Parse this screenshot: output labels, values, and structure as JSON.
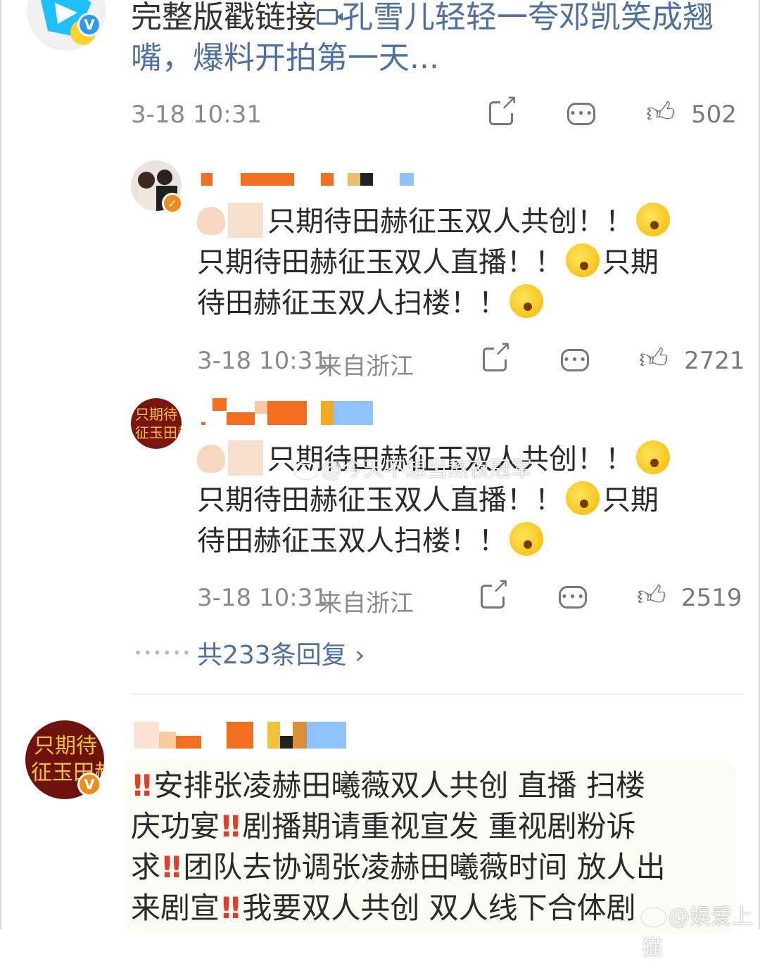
{
  "colors": {
    "link": "#4d6fa8",
    "meta_text": "#8a8a8a",
    "alert_red": "#e43b2a",
    "verified_blue": "#2b9bf0",
    "verified_orange": "#f08a1a",
    "quote_bg": "#fbfcf3"
  },
  "top_post": {
    "text_plain": "完整版戳链接",
    "link_icon": "video-icon",
    "link_text": "孔雪儿轻轻一夸邓凯笑成翘嘴，爆料开拍第一天...",
    "time": "3-18 10:31",
    "like_count": "502",
    "badge": "V"
  },
  "replies": [
    {
      "username": "",
      "line1_text": "只期待田赫征玉双人共创！！",
      "line2_text": "只期待田赫征玉双人直播！！",
      "line2_tail": "只期",
      "line3_text": "待田赫征玉双人扫楼！！",
      "time": "3-18 10:31",
      "location": "来自浙江",
      "like_count": "2721"
    },
    {
      "username": "",
      "line1_text": "只期待田赫征玉双人共创！！",
      "line2_text": "只期待田赫征玉双人直播！！",
      "line2_tail": "只期",
      "line3_text": "待田赫征玉双人扫楼！！",
      "time": "3-18 10:31",
      "location": "来自浙江",
      "like_count": "2519"
    }
  ],
  "more_replies": {
    "label": "共233条回复",
    "chevron": "›"
  },
  "bottom_comment": {
    "badge": "V",
    "avatar_text": "只期待征玉田赫",
    "seg1": "安排张凌赫田曦薇双人共创 直播 扫楼",
    "seg2a": "庆功宴",
    "seg2b": "剧播期请重视宣发 重视剧粉诉",
    "seg3a": "求",
    "seg3b": "团队去协调张凌赫田曦薇时间 放人出",
    "seg4a": "来剧宣",
    "seg4b": "我要双人共创 双人线下合体剧"
  },
  "watermarks": {
    "center": "@今天不想当熬夜冠军",
    "bottom_right": "@娱爱上猫"
  }
}
